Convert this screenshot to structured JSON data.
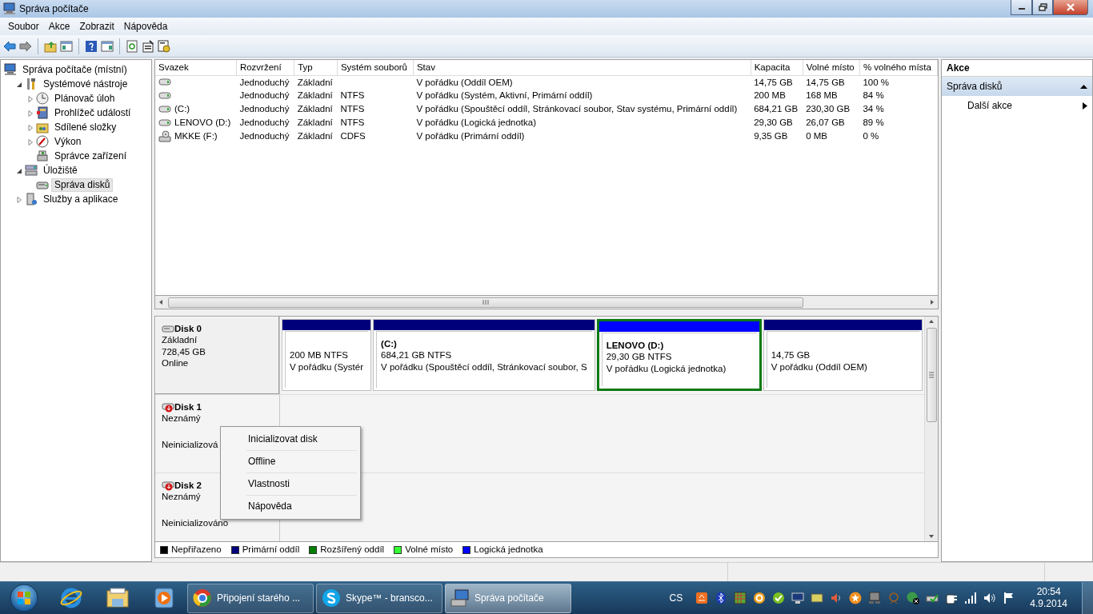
{
  "window": {
    "title": "Správa počítače"
  },
  "menu": [
    "Soubor",
    "Akce",
    "Zobrazit",
    "Nápověda"
  ],
  "tree": [
    {
      "label": "Správa počítače (místní)",
      "selected": false,
      "children": [
        {
          "label": "Systémové nástroje",
          "expanded": true,
          "selected": false,
          "children": [
            {
              "label": "Plánovač úloh",
              "expanded": false,
              "selected": false
            },
            {
              "label": "Prohlížeč událostí",
              "expanded": false,
              "selected": false
            },
            {
              "label": "Sdílené složky",
              "expanded": false,
              "selected": false
            },
            {
              "label": "Výkon",
              "expanded": false,
              "selected": false
            },
            {
              "label": "Správce zařízení",
              "selected": false
            }
          ]
        },
        {
          "label": "Úložiště",
          "expanded": true,
          "selected": false,
          "children": [
            {
              "label": "Správa disků",
              "selected": true
            }
          ]
        },
        {
          "label": "Služby a aplikace",
          "expanded": false,
          "selected": false
        }
      ]
    }
  ],
  "volumes": {
    "columns": [
      "Svazek",
      "Rozvržení",
      "Typ",
      "Systém souborů",
      "Stav",
      "Kapacita",
      "Volné místo",
      "% volného místa"
    ],
    "rows": [
      {
        "kind": "disk",
        "layout": "Jednoduchý",
        "type": "Základní",
        "status": "V pořádku (Oddíl OEM)",
        "capacity": "14,75 GB",
        "free_space": "14,75 GB",
        "percent_free": "100 %"
      },
      {
        "kind": "disk",
        "layout": "Jednoduchý",
        "type": "Základní",
        "file_system": "NTFS",
        "status": "V pořádku (Systém, Aktivní, Primární oddíl)",
        "capacity": "200 MB",
        "free_space": "168 MB",
        "percent_free": "84 %"
      },
      {
        "kind": "disk",
        "volume": "(C:)",
        "layout": "Jednoduchý",
        "type": "Základní",
        "file_system": "NTFS",
        "status": "V pořádku (Spouštěcí oddíl, Stránkovací soubor, Stav systému, Primární oddíl)",
        "capacity": "684,21 GB",
        "free_space": "230,30 GB",
        "percent_free": "34 %"
      },
      {
        "kind": "disk",
        "volume": "LENOVO (D:)",
        "layout": "Jednoduchý",
        "type": "Základní",
        "file_system": "NTFS",
        "status": "V pořádku (Logická jednotka)",
        "capacity": "29,30 GB",
        "free_space": "26,07 GB",
        "percent_free": "89 %"
      },
      {
        "kind": "optical",
        "volume": "MKKE (F:)",
        "layout": "Jednoduchý",
        "type": "Základní",
        "file_system": "CDFS",
        "status": "V pořádku (Primární oddíl)",
        "capacity": "9,35 GB",
        "free_space": "0 MB",
        "percent_free": "0 %"
      }
    ]
  },
  "disks": [
    {
      "kind": "basic",
      "name": "Disk 0",
      "type": "Základní",
      "size": "728,45 GB",
      "status": "Online",
      "partitions": [
        {
          "kind": "primary",
          "color": "#00007b",
          "size": "200 MB NTFS",
          "status": "V pořádku (Systér"
        },
        {
          "kind": "primary",
          "color": "#00007b",
          "label": "(C:)",
          "size": "684,21 GB NTFS",
          "status": "V pořádku (Spouštěcí oddíl, Stránkovací soubor, S"
        },
        {
          "kind": "logical",
          "color": "#0000ff",
          "label": "LENOVO  (D:)",
          "size": "29,30 GB NTFS",
          "status": "V pořádku (Logická jednotka)"
        },
        {
          "kind": "primary",
          "color": "#00007b",
          "size": "14,75 GB",
          "status": "V pořádku (Oddíl OEM)"
        }
      ]
    },
    {
      "kind": "unknown",
      "name": "Disk 1",
      "type": "Neznámý",
      "status": "Neinicializová"
    },
    {
      "kind": "unknown",
      "name": "Disk 2",
      "type": "Neznámý",
      "status": "Neinicializováno"
    }
  ],
  "legend": [
    {
      "label": "Nepřiřazeno",
      "color": "#000000"
    },
    {
      "label": "Primární oddíl",
      "color": "#00007b"
    },
    {
      "label": "Rozšířený oddíl",
      "color": "#008000"
    },
    {
      "label": "Volné místo",
      "color": "#33ff33"
    },
    {
      "label": "Logická jednotka",
      "color": "#0000ff"
    }
  ],
  "context_menu": [
    "Inicializovat disk",
    "Offline",
    "Vlastnosti",
    "Nápověda"
  ],
  "actions": {
    "title": "Akce",
    "sections": [
      {
        "label": "Správa disků",
        "expanded": true,
        "items": [
          "Další akce"
        ]
      }
    ]
  },
  "taskbar": {
    "tasks": [
      {
        "label": "Připojení starého ...",
        "selected": false
      },
      {
        "label": "Skype™ - bransco...",
        "selected": false
      },
      {
        "label": "Správa počítače",
        "selected": true
      }
    ],
    "language": "CS",
    "time": "20:54",
    "date": "4.9.2014"
  }
}
